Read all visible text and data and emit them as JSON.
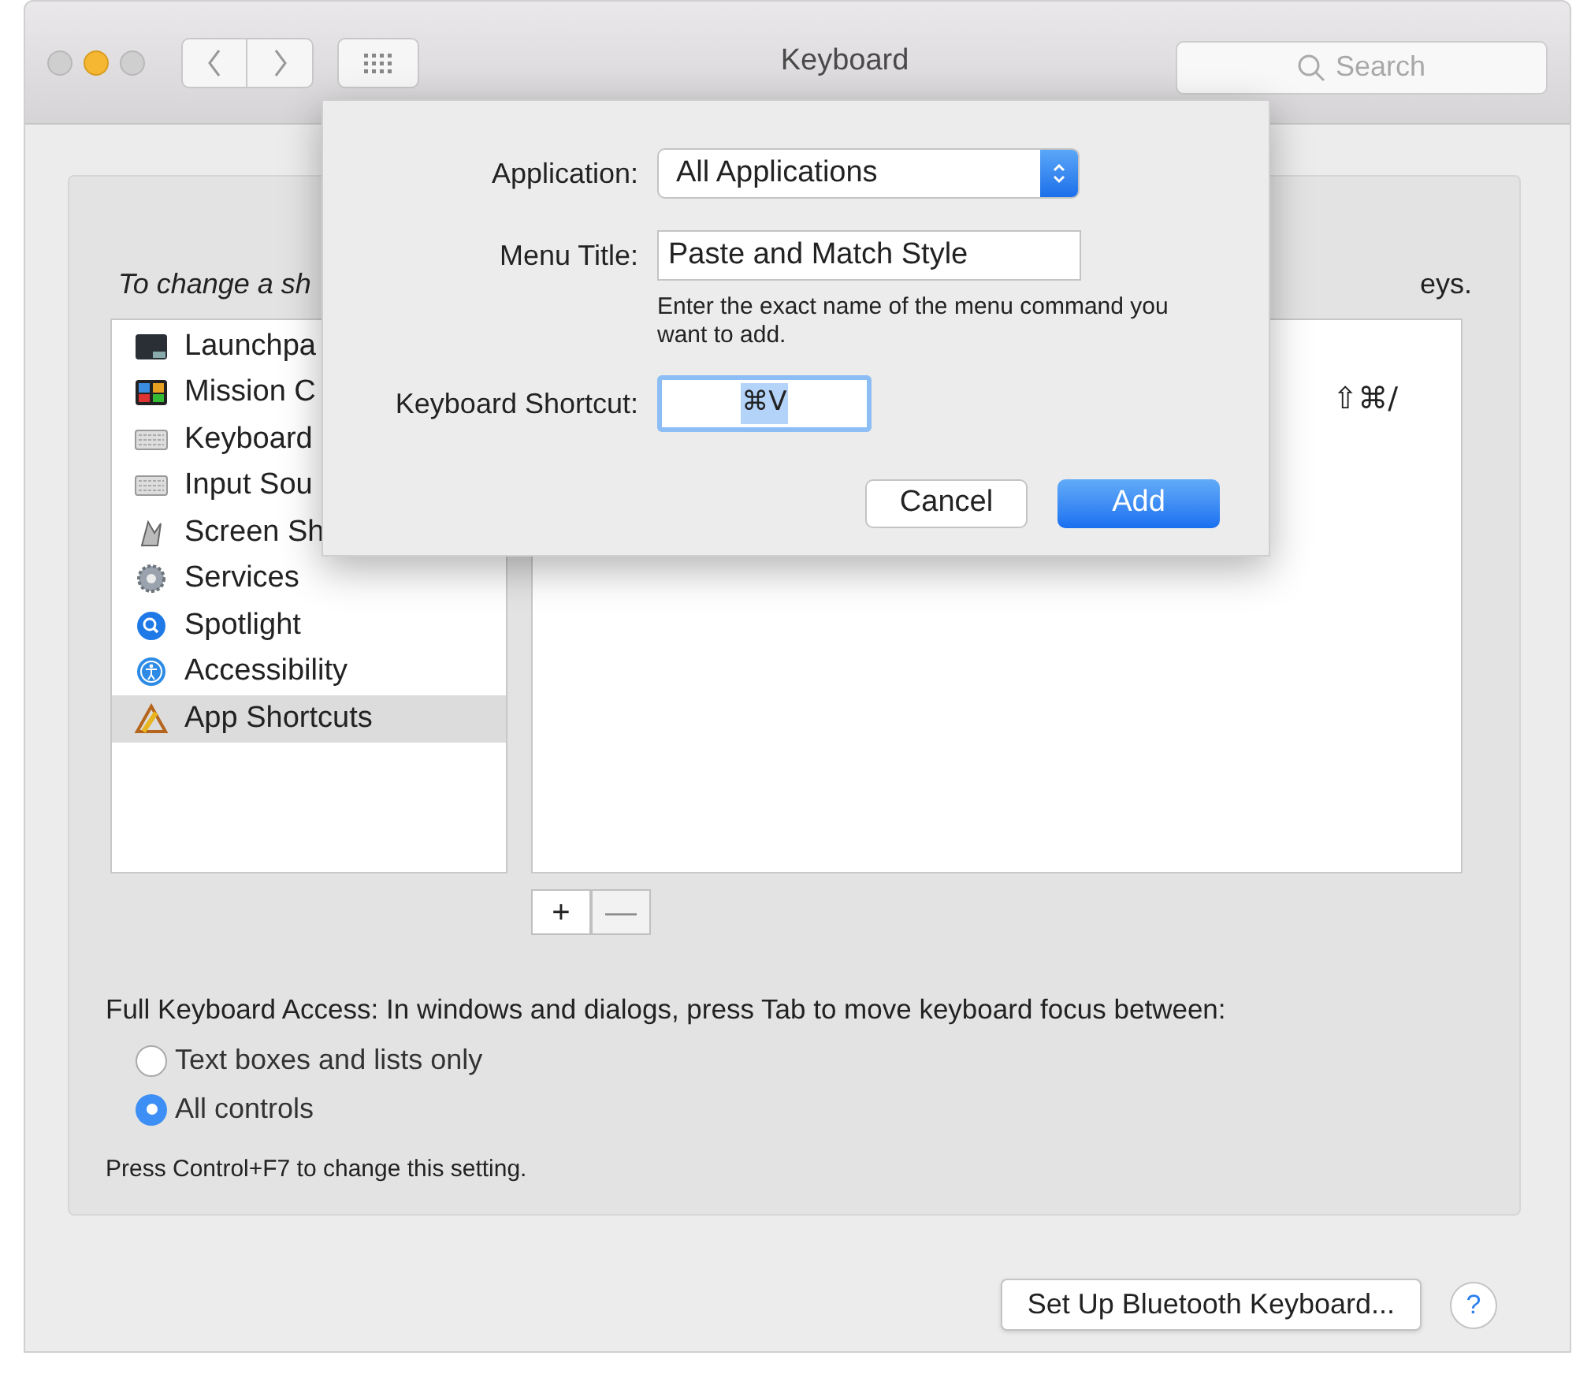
{
  "window": {
    "title": "Keyboard"
  },
  "search": {
    "placeholder": "Search"
  },
  "instruction": {
    "text": "To change a sh",
    "text_end": "eys."
  },
  "categories": [
    {
      "label": "Launchpa",
      "selected": false
    },
    {
      "label": "Mission C",
      "selected": false
    },
    {
      "label": "Keyboard",
      "selected": false
    },
    {
      "label": "Input Sou",
      "selected": false
    },
    {
      "label": "Screen Sh",
      "selected": false
    },
    {
      "label": "Services",
      "selected": false
    },
    {
      "label": "Spotlight",
      "selected": false
    },
    {
      "label": "Accessibility",
      "selected": false
    },
    {
      "label": "App Shortcuts",
      "selected": true
    }
  ],
  "shortcuts": [
    {
      "column_2": "⇧⌘/"
    }
  ],
  "list_buttons": [
    {
      "symbol": "+",
      "disabled": false
    },
    {
      "symbol": "—",
      "disabled": true
    }
  ],
  "full_keyboard_access": {
    "label": "Full Keyboard Access: In windows and dialogs, press Tab to move keyboard focus between:",
    "options": [
      {
        "label": "Text boxes and lists only",
        "selected": false
      },
      {
        "label": "All controls",
        "selected": true
      }
    ],
    "note": "Press Control+F7 to change this setting."
  },
  "bluetooth_button": "Set Up Bluetooth Keyboard...",
  "help_button": "?",
  "dialog": {
    "application": {
      "label": "Application:",
      "value": "All Applications"
    },
    "menu_title": {
      "label": "Menu Title:",
      "value": "Paste and Match Style",
      "hint": "Enter the exact name of the menu command you want to add."
    },
    "keyboard_shortcut": {
      "label": "Keyboard Shortcut:",
      "value": "⌘V"
    },
    "buttons": [
      {
        "label": "Cancel",
        "kind": "cancel"
      },
      {
        "label": "Add",
        "kind": "default"
      }
    ]
  }
}
